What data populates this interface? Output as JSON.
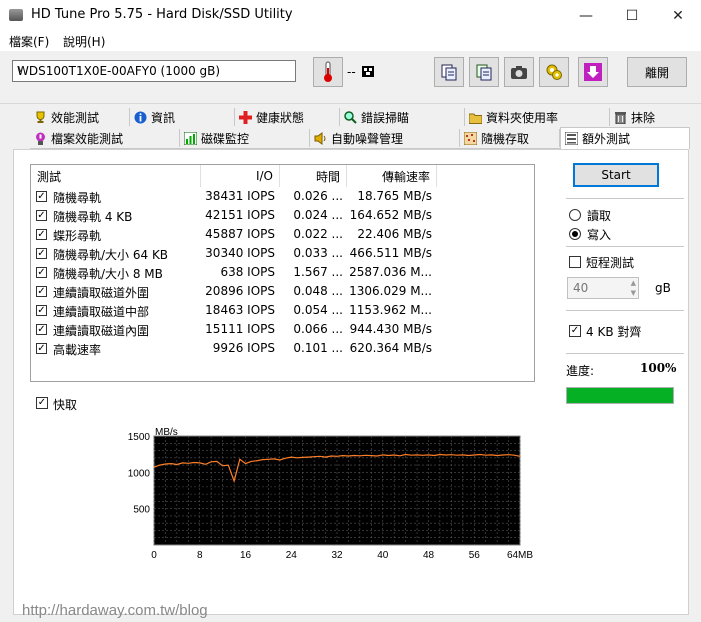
{
  "window": {
    "title": "HD Tune Pro 5.75 - Hard Disk/SSD Utility"
  },
  "menu": {
    "items": [
      "檔案(F)",
      "說明(H)"
    ]
  },
  "toolbar": {
    "drive": "WDS100T1X0E-00AFY0 (1000 gB)",
    "temperature": "-- ",
    "exit_label": "離開"
  },
  "tabs": {
    "row1": [
      {
        "label": "效能測試",
        "icon": "trophy-icon"
      },
      {
        "label": "資訊",
        "icon": "info-icon"
      },
      {
        "label": "健康狀態",
        "icon": "health-cross-icon"
      },
      {
        "label": "錯誤掃瞄",
        "icon": "magnifier-icon"
      },
      {
        "label": "資料夾使用率",
        "icon": "folder-icon"
      },
      {
        "label": "抹除",
        "icon": "trash-icon"
      }
    ],
    "row2": [
      {
        "label": "檔案效能測試",
        "icon": "file-benchmark-icon"
      },
      {
        "label": "磁碟監控",
        "icon": "monitor-icon"
      },
      {
        "label": "自動噪聲管理",
        "icon": "speaker-icon"
      },
      {
        "label": "隨機存取",
        "icon": "random-access-icon"
      },
      {
        "label": "額外測試",
        "icon": "extra-tests-icon"
      }
    ]
  },
  "table": {
    "headers": [
      "測試",
      "I/O",
      "時間",
      "傳輸速率"
    ],
    "rows": [
      {
        "test": "隨機尋軌",
        "io": "38431 IOPS",
        "time": "0.026 ...",
        "rate": "18.765 MB/s"
      },
      {
        "test": "隨機尋軌 4 KB",
        "io": "42151 IOPS",
        "time": "0.024 ...",
        "rate": "164.652 MB/s"
      },
      {
        "test": "蝶形尋軌",
        "io": "45887 IOPS",
        "time": "0.022 ...",
        "rate": "22.406 MB/s"
      },
      {
        "test": "隨機尋軌/大小 64 KB",
        "io": "30340 IOPS",
        "time": "0.033 ...",
        "rate": "466.511 MB/s"
      },
      {
        "test": "隨機尋軌/大小 8 MB",
        "io": "638 IOPS",
        "time": "1.567 ...",
        "rate": "2587.036 M..."
      },
      {
        "test": "連續讀取磁道外圍",
        "io": "20896 IOPS",
        "time": "0.048 ...",
        "rate": "1306.029 M..."
      },
      {
        "test": "連續讀取磁道中部",
        "io": "18463 IOPS",
        "time": "0.054 ...",
        "rate": "1153.962 M..."
      },
      {
        "test": "連續讀取磁道內圍",
        "io": "15111 IOPS",
        "time": "0.066 ...",
        "rate": "944.430 MB/s"
      },
      {
        "test": "高載速率",
        "io": "9926 IOPS",
        "time": "0.101 ...",
        "rate": "620.364 MB/s"
      }
    ]
  },
  "quick": {
    "label": "快取"
  },
  "controls": {
    "start_label": "Start",
    "read_label": "讀取",
    "write_label": "寫入",
    "short_test_label": "短程測試",
    "short_value": "40",
    "unit": "gB",
    "align_label": "4 KB 對齊",
    "progress_label": "進度:",
    "progress_value": "100%",
    "progress_fraction": 1.0
  },
  "watermark": "http://hardaway.com.tw/blog",
  "chart_data": {
    "type": "line",
    "ylabel": "MB/s",
    "ylim": [
      0,
      1500
    ],
    "yticks": [
      500,
      1000,
      1500
    ],
    "xlim": [
      0,
      64
    ],
    "xticks": [
      0,
      8,
      16,
      24,
      32,
      40,
      48,
      56,
      64
    ],
    "xunit": "MB",
    "grid": true,
    "series": [
      {
        "x": [
          0,
          1,
          2,
          3,
          4,
          5,
          6,
          7,
          8,
          9,
          10,
          11,
          12,
          13,
          14,
          15,
          16,
          17,
          18,
          19,
          20,
          21,
          22,
          23,
          24,
          25,
          26,
          27,
          28,
          29,
          30,
          31,
          32,
          33,
          34,
          35,
          36,
          37,
          38,
          39,
          40,
          41,
          42,
          43,
          44,
          45,
          46,
          47,
          48,
          49,
          50,
          51,
          52,
          53,
          54,
          55,
          56,
          57,
          58,
          59,
          60,
          61,
          62,
          63,
          64
        ],
        "values": [
          1070,
          1100,
          1115,
          1120,
          1108,
          1130,
          1125,
          1135,
          1130,
          1110,
          1145,
          1150,
          1090,
          1100,
          880,
          1180,
          1120,
          1150,
          1160,
          1175,
          1180,
          1185,
          1170,
          1195,
          1210,
          1200,
          1205,
          1210,
          1215,
          1220,
          1210,
          1225,
          1220,
          1230,
          1225,
          1232,
          1228,
          1235,
          1230,
          1225,
          1240,
          1232,
          1238,
          1228,
          1245,
          1236,
          1240,
          1235,
          1240,
          1232,
          1245,
          1238,
          1242,
          1236,
          1240,
          1232,
          1238,
          1245,
          1236,
          1240,
          1232,
          1238,
          1242,
          1236,
          1220
        ]
      }
    ]
  },
  "colors": {
    "chart_bg": "#000000",
    "chart_line": "#ff7f27",
    "grid": "#555555",
    "progress": "#06b025",
    "accent": "#0078d7"
  }
}
